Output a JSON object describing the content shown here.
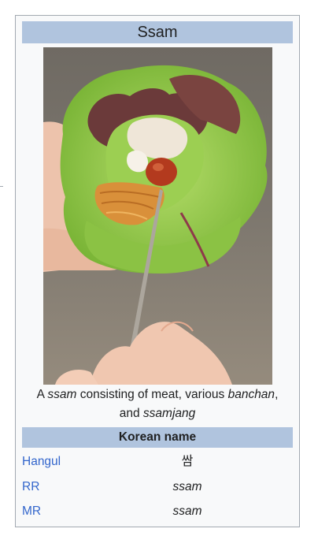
{
  "infobox": {
    "title": "Ssam",
    "image": {
      "subject": "lettuce wrap with meat, banchan and ssamjang held by chopsticks",
      "colors": {
        "background_top": "#6f6a63",
        "background_bottom": "#8b8377",
        "lettuce": "#8cc63f",
        "lettuce_dark": "#5f9a2a",
        "red_leaf": "#6b3a3a",
        "skin": "#f0c9b4",
        "noodles": "#d9903a",
        "ssamjang": "#b33a1e",
        "chopstick": "#a9a39a"
      }
    },
    "caption": {
      "p1": "A ",
      "i1": "ssam",
      "p2": " consisting of meat, various ",
      "i2": "banchan",
      "p3": ",",
      "p4": "and ",
      "i3": "ssamjang"
    },
    "subheader": "Korean name",
    "rows": [
      {
        "label": "Hangul",
        "value": "쌈"
      },
      {
        "label": "RR",
        "value": "ssam"
      },
      {
        "label": "MR",
        "value": "ssam"
      }
    ],
    "colors": {
      "header_bg": "#b0c4de",
      "box_bg": "#f8f9fa",
      "border": "#a2a9b1",
      "link": "#3366cc"
    }
  }
}
